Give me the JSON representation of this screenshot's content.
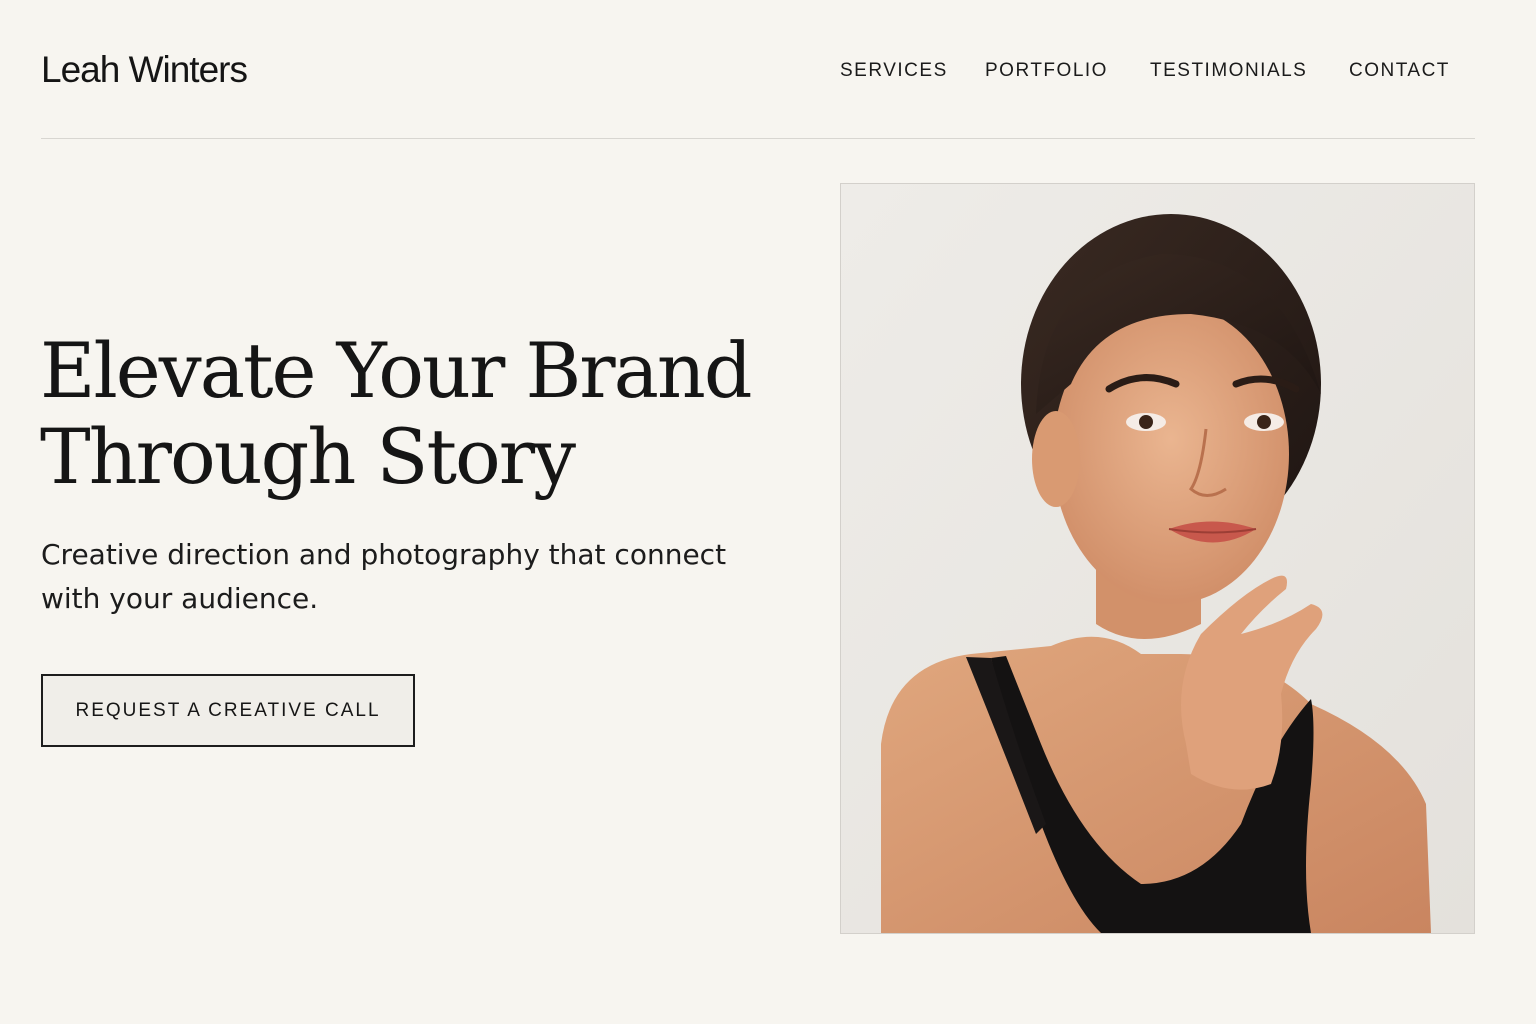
{
  "header": {
    "brand": "Leah Winters",
    "nav": [
      "SERVICES",
      "PORTFOLIO",
      "TESTIMONIALS",
      "CONTACT"
    ]
  },
  "hero": {
    "headline": [
      "Elevate Your Brand",
      "Through Story"
    ],
    "subtext": [
      "Creative direction and photography that connect",
      "with your audience."
    ],
    "cta_label": "REQUEST A CREATIVE CALL"
  },
  "colors": {
    "background": "#f7f5f0",
    "text": "#161616",
    "divider": "#d8d6d1",
    "photo_background": "#ebe8e4"
  }
}
